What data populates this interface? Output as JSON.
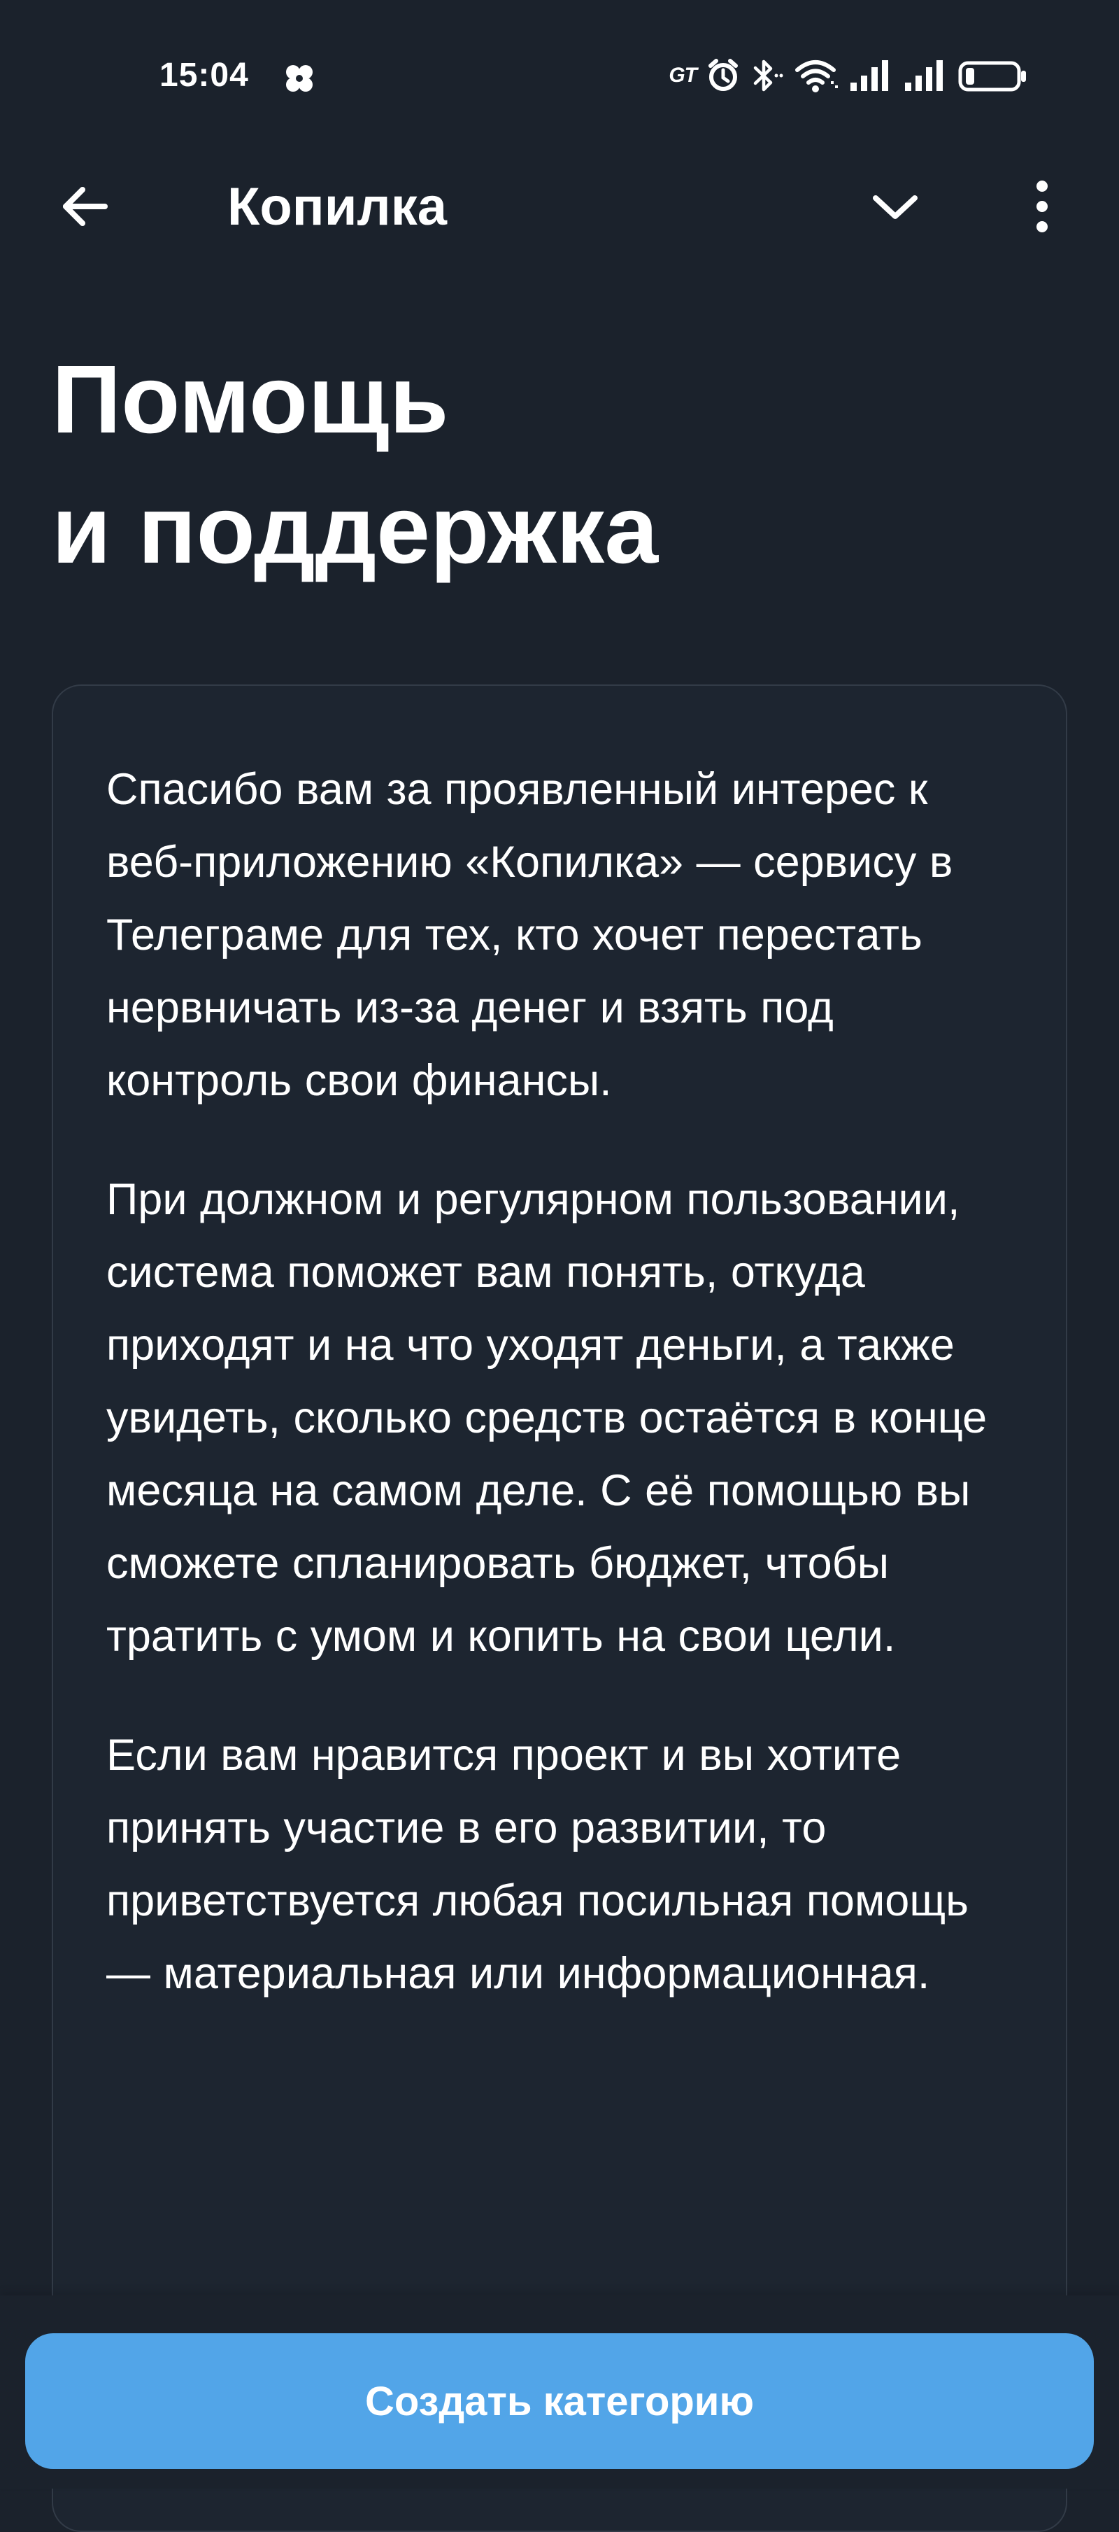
{
  "status_bar": {
    "time": "15:04",
    "carrier_badge": "GT"
  },
  "header": {
    "title": "Копилка"
  },
  "page": {
    "title_line1": "Помощь",
    "title_line2": "и поддержка"
  },
  "content": {
    "paragraphs": [
      "Спасибо вам за проявленный интерес к веб-приложению «Копилка» — сервису в Телеграме для тех, кто хочет перестать нервничать из-за денег и взять под контроль свои финансы.",
      "При должном и регулярном пользовании, система поможет вам понять, откуда приходят и на что уходят деньги, а также увидеть, сколько средств остаётся в конце месяца на самом деле. С её помощью вы сможете спланировать бюджет, чтобы тратить с умом и копить на свои цели.",
      "Если вам нравится проект и вы хотите принять участие в его развитии, то приветствуется любая посильная помощь — материальная или информационная."
    ]
  },
  "bottom_bar": {
    "create_category_label": "Создать категорию"
  },
  "icons": {
    "status_app": "clover-icon",
    "alarm": "alarm-icon",
    "bluetooth": "bluetooth-icon",
    "wifi": "wifi-icon",
    "signal": "signal-icon",
    "battery": "battery-icon",
    "back": "arrow-left-icon",
    "collapse": "chevron-down-icon",
    "more": "more-vertical-icon"
  },
  "colors": {
    "background": "#1b222c",
    "card_background": "#1d2530",
    "card_border": "#323b47",
    "accent_button": "#52a5e8",
    "text": "#ffffff"
  }
}
